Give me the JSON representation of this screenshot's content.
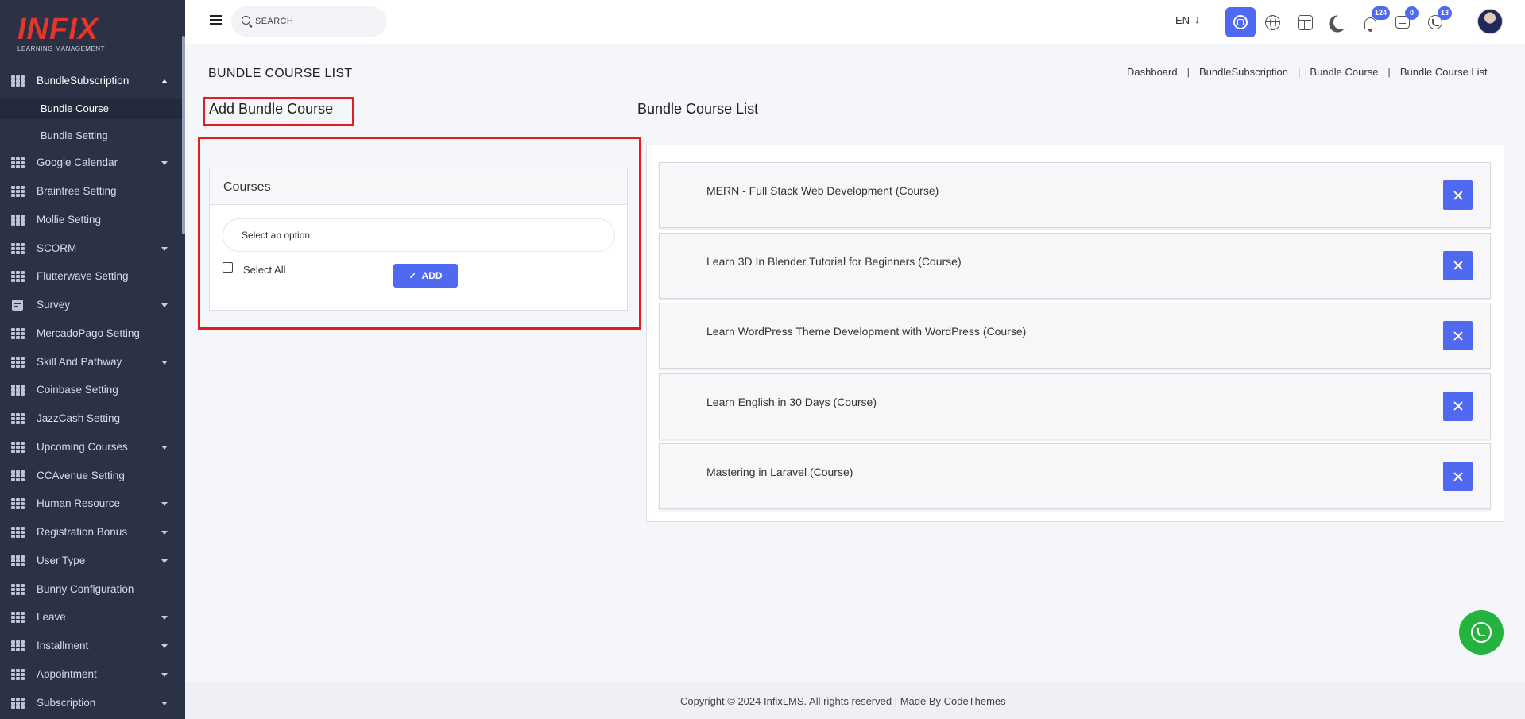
{
  "logo": {
    "main": "INFIX",
    "sub": "LEARNING MANAGEMENT"
  },
  "sidebar": {
    "items": [
      {
        "label": "BundleSubscription",
        "arrow": "up",
        "icon": "grid-icon"
      },
      {
        "label": "Bundle Course",
        "sub": true,
        "active": true
      },
      {
        "label": "Bundle Setting",
        "sub": true
      },
      {
        "label": "Google Calendar",
        "arrow": "down",
        "icon": "grid-icon"
      },
      {
        "label": "Braintree Setting",
        "icon": "grid-icon"
      },
      {
        "label": "Mollie Setting",
        "icon": "grid-icon"
      },
      {
        "label": "SCORM",
        "arrow": "down",
        "icon": "grid-icon"
      },
      {
        "label": "Flutterwave Setting",
        "icon": "grid-icon"
      },
      {
        "label": "Survey",
        "arrow": "down",
        "icon": "document-icon"
      },
      {
        "label": "MercadoPago Setting",
        "icon": "grid-icon"
      },
      {
        "label": "Skill And Pathway",
        "arrow": "down",
        "icon": "grid-icon"
      },
      {
        "label": "Coinbase Setting",
        "icon": "grid-icon"
      },
      {
        "label": "JazzCash Setting",
        "icon": "grid-icon"
      },
      {
        "label": "Upcoming Courses",
        "arrow": "down",
        "icon": "grid-icon"
      },
      {
        "label": "CCAvenue Setting",
        "icon": "grid-icon"
      },
      {
        "label": "Human Resource",
        "arrow": "down",
        "icon": "grid-icon"
      },
      {
        "label": "Registration Bonus",
        "arrow": "down",
        "icon": "grid-icon"
      },
      {
        "label": "User Type",
        "arrow": "down",
        "icon": "grid-icon"
      },
      {
        "label": "Bunny Configuration",
        "icon": "grid-icon"
      },
      {
        "label": "Leave",
        "arrow": "down",
        "icon": "grid-icon"
      },
      {
        "label": "Installment",
        "arrow": "down",
        "icon": "grid-icon"
      },
      {
        "label": "Appointment",
        "arrow": "down",
        "icon": "grid-icon"
      },
      {
        "label": "Subscription",
        "arrow": "down",
        "icon": "grid-icon"
      }
    ]
  },
  "header": {
    "search_placeholder": "SEARCH",
    "language": "EN",
    "language_arrow": "↓",
    "badges": {
      "notifications": "124",
      "messages": "0",
      "whatsapp": "13"
    }
  },
  "page": {
    "title": "BUNDLE COURSE LIST",
    "breadcrumb": [
      "Dashboard",
      "BundleSubscription",
      "Bundle Course",
      "Bundle Course List"
    ]
  },
  "add_section": {
    "title": "Add Bundle Course",
    "card_title": "Courses",
    "select_placeholder": "Select an option",
    "select_all_label": "Select All",
    "add_button": "ADD",
    "add_button_icon": "✓"
  },
  "list_section": {
    "title": "Bundle Course List",
    "items": [
      "MERN - Full Stack Web Development (Course)",
      "Learn 3D In Blender Tutorial for Beginners (Course)",
      "Learn WordPress Theme Development with WordPress (Course)",
      "Learn English in 30 Days (Course)",
      "Mastering in Laravel (Course)"
    ]
  },
  "footer": {
    "text": "Copyright © 2024 InfixLMS. All rights reserved | Made By CodeThemes"
  },
  "colors": {
    "accent": "#4f6af0",
    "sidebar": "#2b3245",
    "highlight": "#e51d1d",
    "whatsapp": "#25b33f",
    "logo": "#e4362c"
  }
}
